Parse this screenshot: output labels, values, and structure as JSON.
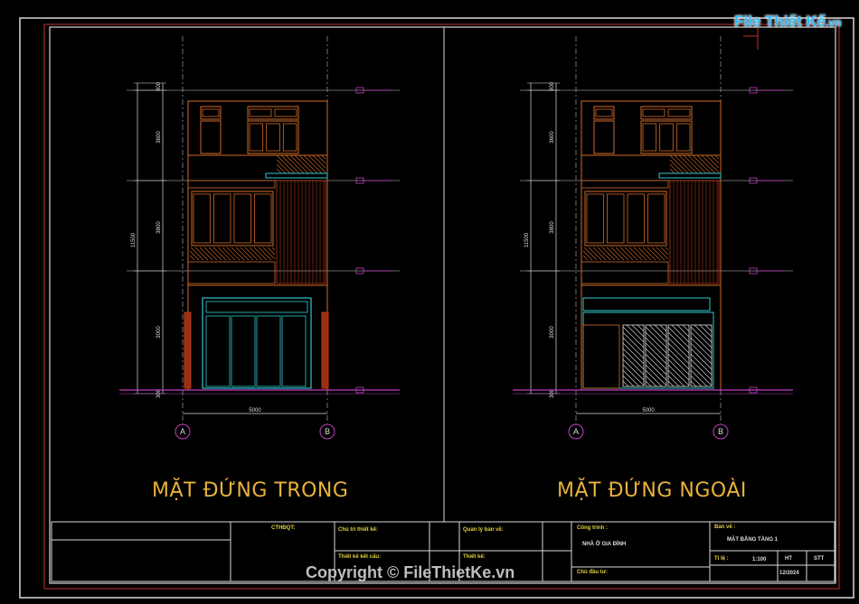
{
  "logo": {
    "main": "File Thiết Kế",
    "suffix": ".vn"
  },
  "drawings": [
    {
      "title": "MẶT ĐỨNG TRONG",
      "dims": {
        "total": "11500",
        "top": "900",
        "floor3": "3600",
        "floor2": "3800",
        "ground": "3000",
        "base": "300",
        "width": "5000"
      },
      "axes": [
        "A",
        "B"
      ]
    },
    {
      "title": "MẶT ĐỨNG NGOÀI",
      "dims": {
        "total": "11500",
        "top": "900",
        "floor3": "3600",
        "floor2": "3800",
        "ground": "3000",
        "base": "300",
        "width": "5000"
      },
      "axes": [
        "A",
        "B"
      ]
    }
  ],
  "title_block": {
    "cthsqt": "CTHĐQT:",
    "chu_tri": "Chủ trì thiết kế:",
    "thiet_ke_ket_cau": "Thiết kế kết cấu:",
    "quan_ly": "Quản lý bản vẽ:",
    "thiet_ke": "Thiết kế:",
    "cong_trinh_label": "Công trình :",
    "cong_trinh_value": "NHÀ Ở GIA ĐÌNH",
    "chu_dau_tu": "Chủ đầu tư:",
    "ban_ve_label": "Bản vẽ :",
    "ban_ve_value": "MẶT BẰNG TẦNG 1",
    "ty_le_label": "Tỉ lệ :",
    "ty_le_value": "1:100",
    "ht": "HT",
    "stt": "STT",
    "date": "12/2024"
  },
  "copyright": "Copyright © FileThietKe.vn"
}
